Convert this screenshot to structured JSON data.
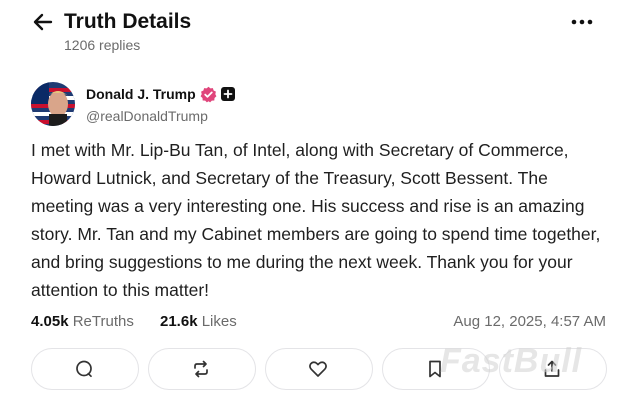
{
  "header": {
    "title": "Truth Details",
    "replies": "1206 replies",
    "back_icon": "arrow-left-icon",
    "more_icon": "more-horizontal-icon"
  },
  "author": {
    "name": "Donald J. Trump",
    "handle": "@realDonaldTrump",
    "verified_color": "#e0457b"
  },
  "post": {
    "text": "I met with Mr. Lip-Bu Tan, of Intel, along with Secretary of Commerce, Howard Lutnick, and Secretary of the Treasury, Scott Bessent. The meeting was a very interesting one. His success and rise is an amazing story. Mr. Tan and my Cabinet members are going to spend time together, and bring suggestions to me during the next week. Thank you for your attention to this matter!",
    "retruths_count": "4.05k",
    "retruths_label": "ReTruths",
    "likes_count": "21.6k",
    "likes_label": "Likes",
    "date": "Aug 12, 2025, 4:57 AM"
  },
  "actions": [
    {
      "icon": "reply-icon"
    },
    {
      "icon": "retruth-icon"
    },
    {
      "icon": "like-icon"
    },
    {
      "icon": "bookmark-icon"
    },
    {
      "icon": "share-icon"
    }
  ],
  "watermark": "FastBull"
}
